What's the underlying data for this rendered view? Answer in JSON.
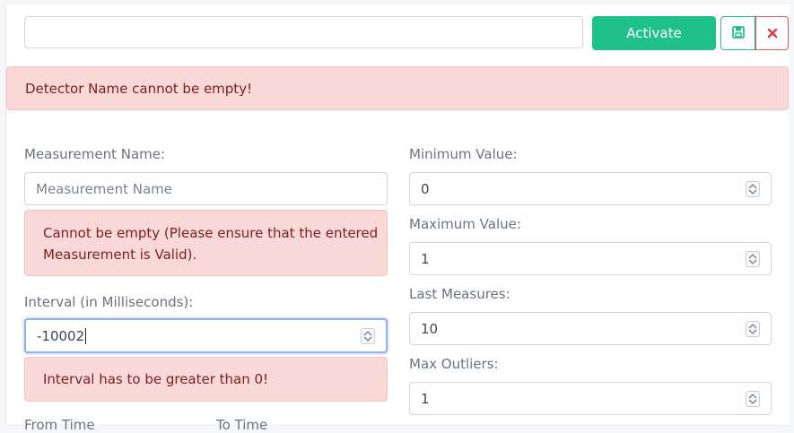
{
  "header": {
    "detector_name_value": "",
    "activate_label": "Activate",
    "save_icon": "save-icon",
    "close_icon": "close-icon"
  },
  "alerts": {
    "detector_name_error": "Detector Name cannot be empty!",
    "measurement_error": "Cannot be empty (Please ensure that the entered Measurement is Valid).",
    "interval_error": "Interval has to be greater than 0!"
  },
  "form": {
    "measurement_name": {
      "label": "Measurement Name:",
      "placeholder": "Measurement Name",
      "value": ""
    },
    "interval": {
      "label": "Interval (in Milliseconds):",
      "value": "-10002"
    },
    "minimum_value": {
      "label": "Minimum Value:",
      "value": "0"
    },
    "maximum_value": {
      "label": "Maximum Value:",
      "value": "1"
    },
    "last_measures": {
      "label": "Last Measures:",
      "value": "10"
    },
    "max_outliers": {
      "label": "Max Outliers:",
      "value": "1"
    },
    "from_time_label": "From Time",
    "to_time_label": "To Time"
  },
  "colors": {
    "accent": "#20c08a",
    "danger": "#e15b5b",
    "alert_bg": "#f9d9d8",
    "alert_text": "#7a2020"
  }
}
